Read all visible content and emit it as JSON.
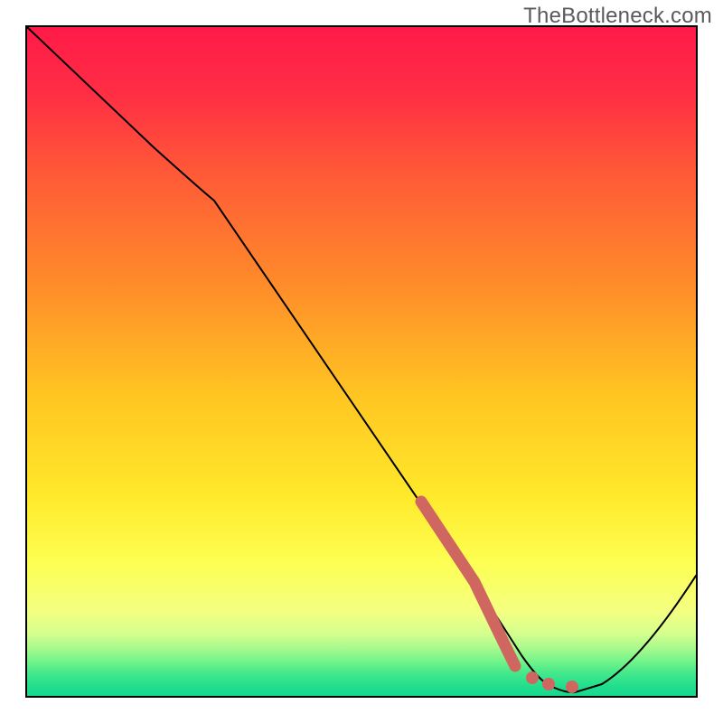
{
  "watermark": "TheBottleneck.com",
  "colors": {
    "border": "#000000",
    "curve": "#000000",
    "marker": "#cf6760",
    "gradient_top": "#ff1a49",
    "gradient_mid1": "#ff8a2a",
    "gradient_mid2": "#ffe92a",
    "gradient_low": "#f6ff7a",
    "gradient_green1": "#7cf58a",
    "gradient_green2": "#2fe08a",
    "gradient_green3": "#17d88e"
  },
  "chart_data": {
    "type": "line",
    "title": "",
    "xlabel": "",
    "ylabel": "",
    "xlim": [
      0,
      100
    ],
    "ylim": [
      0,
      100
    ],
    "series": [
      {
        "name": "bottleneck-curve",
        "x": [
          0,
          19,
          28,
          67,
          70,
          74,
          78,
          82,
          86,
          100
        ],
        "values": [
          100,
          82,
          74,
          17,
          13,
          6,
          2,
          0.5,
          1.5,
          18
        ]
      }
    ],
    "markers": [
      {
        "name": "highlight-segment",
        "type": "thick-line",
        "x": [
          59,
          67,
          70,
          73
        ],
        "values": [
          29,
          17,
          10,
          4
        ]
      },
      {
        "name": "dot-1",
        "type": "dot",
        "x": 75.5,
        "value": 1.8
      },
      {
        "name": "dot-2",
        "type": "dot",
        "x": 78,
        "value": 1.2
      },
      {
        "name": "dot-3",
        "type": "dot",
        "x": 81.5,
        "value": 0.8
      }
    ]
  }
}
